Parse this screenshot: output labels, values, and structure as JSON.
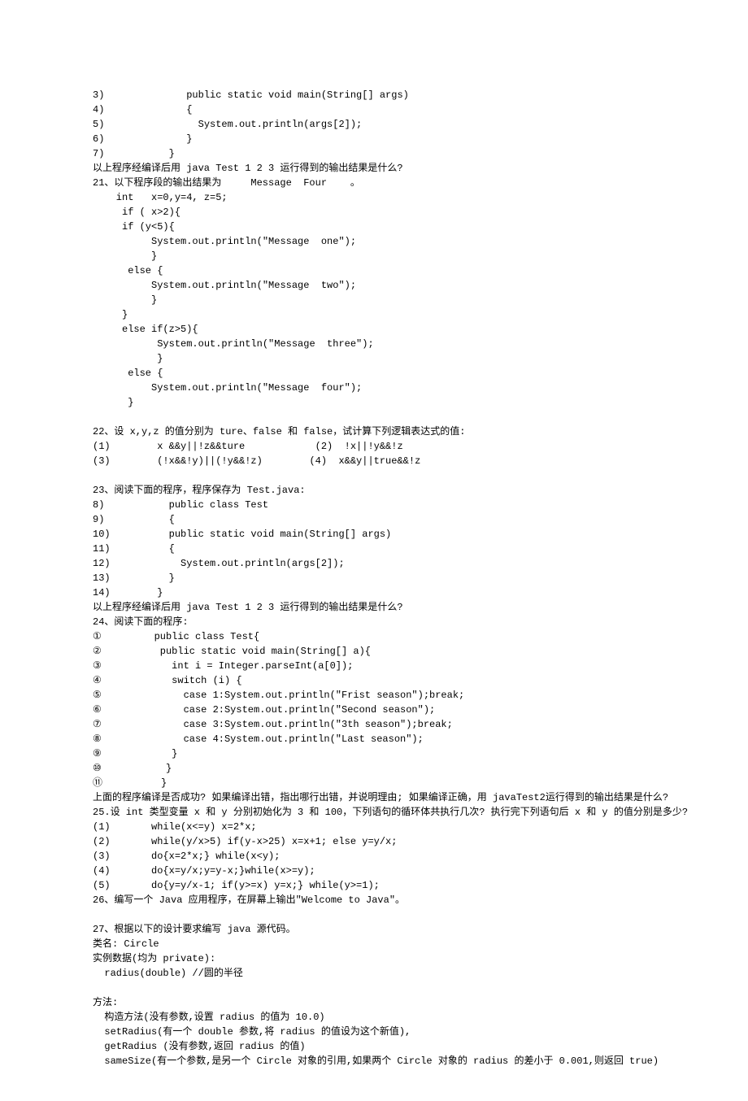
{
  "lines": [
    "3)              public static void main(String[] args)",
    "4)              {",
    "5)                System.out.println(args[2]);",
    "6)              }",
    "7)           }",
    "以上程序经编译后用 java Test 1 2 3 运行得到的输出结果是什么?",
    "21、以下程序段的输出结果为     Message  Four    。",
    "    int   x=0,y=4, z=5;",
    "     if ( x>2){",
    "     if (y<5){",
    "          System.out.println(\"Message  one\");",
    "          }",
    "      else {",
    "          System.out.println(\"Message  two\");",
    "          }",
    "     }",
    "     else if(z>5){",
    "           System.out.println(\"Message  three\");",
    "           }",
    "      else {",
    "          System.out.println(\"Message  four\");",
    "      }",
    "",
    "22、设 x,y,z 的值分别为 ture、false 和 false，试计算下列逻辑表达式的值:",
    "(1)        x &&y||!z&&ture            (2)  !x||!y&&!z",
    "(3)        (!x&&!y)||(!y&&!z)        (4)  x&&y||true&&!z",
    "",
    "23、阅读下面的程序，程序保存为 Test.java:",
    "8)           public class Test",
    "9)           {",
    "10)          public static void main(String[] args)",
    "11)          {",
    "12)            System.out.println(args[2]);",
    "13)          }",
    "14)        }",
    "以上程序经编译后用 java Test 1 2 3 运行得到的输出结果是什么?",
    "24、阅读下面的程序:",
    "①         public class Test{",
    "②          public static void main(String[] a){",
    "③            int i = Integer.parseInt(a[0]);",
    "④            switch (i) {",
    "⑤              case 1:System.out.println(\"Frist season\");break;",
    "⑥              case 2:System.out.println(\"Second season\");",
    "⑦              case 3:System.out.println(\"3th season\");break;",
    "⑧              case 4:System.out.println(\"Last season\");",
    "⑨            }",
    "⑩           }",
    "⑪          }",
    "上面的程序编译是否成功? 如果编译出错，指出哪行出错，并说明理由; 如果编译正确，用 javaTest2运行得到的输出结果是什么?",
    "25.设 int 类型变量 x 和 y 分别初始化为 3 和 100，下列语句的循环体共执行几次? 执行完下列语句后 x 和 y 的值分别是多少?",
    "(1)       while(x<=y) x=2*x;",
    "(2)       while(y/x>5) if(y-x>25) x=x+1; else y=y/x;",
    "(3)       do{x=2*x;} while(x<y);",
    "(4)       do{x=y/x;y=y-x;}while(x>=y);",
    "(5)       do{y=y/x-1; if(y>=x) y=x;} while(y>=1);",
    "26、编写一个 Java 应用程序，在屏幕上输出\"Welcome to Java\"。",
    "",
    "27、根据以下的设计要求编写 java 源代码。",
    "类名: Circle",
    "实例数据(均为 private):",
    "  radius(double) //圆的半径",
    "",
    "方法:",
    "  构造方法(没有参数,设置 radius 的值为 10.0)",
    "  setRadius(有一个 double 参数,将 radius 的值设为这个新值),",
    "  getRadius (没有参数,返回 radius 的值)",
    "  sameSize(有一个参数,是另一个 Circle 对象的引用,如果两个 Circle 对象的 radius 的差小于 0.001,则返回 true)"
  ]
}
